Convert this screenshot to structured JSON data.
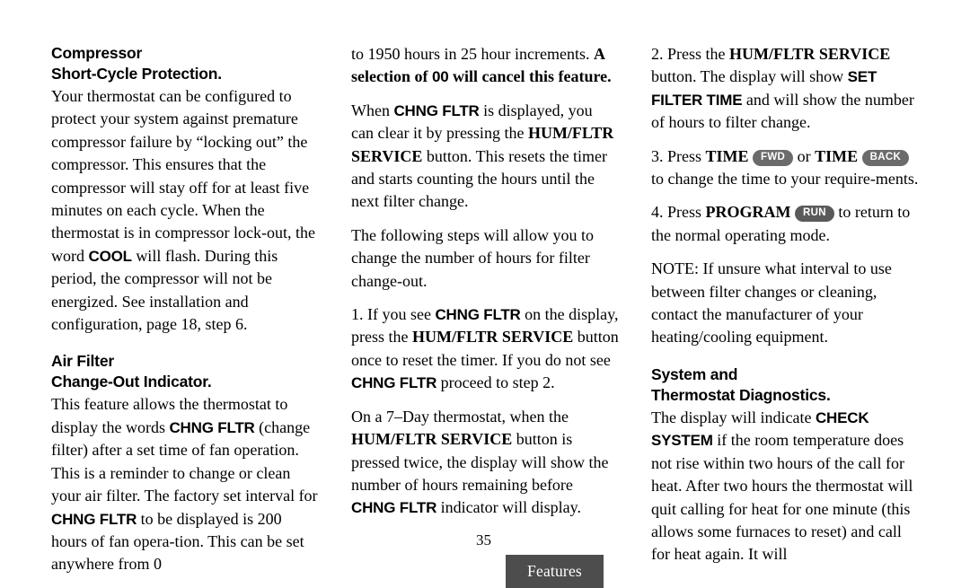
{
  "document": {
    "page_number": "35",
    "footer_tab_label": "Features",
    "footer_tab_color": "#4d4d4d",
    "key_badge_color": "#6b6b6b",
    "key_badge_color_dark": "#5a5a5a"
  },
  "columns": [
    {
      "id": "column-left",
      "blocks": [
        {
          "type": "heading",
          "line1": "Compressor",
          "line2": "Short-Cycle Protection."
        },
        {
          "type": "paragraph",
          "id": "compressor-body",
          "runs": [
            {
              "style": "plain",
              "text": "Your thermostat can be configured to protect your system against premature compressor failure by “locking out” the compressor. This ensures that the compressor will stay off for at least five minutes on each cycle. When the thermostat is in compressor lock-out, the word "
            },
            {
              "style": "display",
              "text": "COOL"
            },
            {
              "style": "plain",
              "text": " will flash. During this period, the compressor will not be energized. See installation and configuration, page 18, step 6."
            }
          ]
        },
        {
          "type": "heading",
          "line1": "Air Filter",
          "line2": "Change-Out Indicator."
        },
        {
          "type": "paragraph",
          "id": "air-filter-body",
          "runs": [
            {
              "style": "plain",
              "text": "This feature allows the thermostat to display the words "
            },
            {
              "style": "display",
              "text": "CHNG FLTR"
            },
            {
              "style": "plain",
              "text": " (change filter) after a set time of fan operation. This is a reminder to change or clean your air filter. The factory set interval for "
            },
            {
              "style": "display",
              "text": "CHNG FLTR"
            },
            {
              "style": "plain",
              "text": " to be displayed is 200 hours of fan opera-tion. This can be set anywhere from 0"
            }
          ]
        }
      ]
    },
    {
      "id": "column-middle",
      "blocks": [
        {
          "type": "paragraph",
          "id": "increment-range",
          "runs": [
            {
              "style": "plain",
              "text": "to 1950 hours in 25 hour increments. "
            },
            {
              "style": "bold-serif",
              "text": "A selection of "
            },
            {
              "style": "display",
              "text": "00"
            },
            {
              "style": "bold-serif",
              "text": " will cancel this feature."
            }
          ]
        },
        {
          "type": "paragraph",
          "id": "clear-chng-fltr",
          "runs": [
            {
              "style": "plain",
              "text": "When "
            },
            {
              "style": "display",
              "text": "CHNG FLTR"
            },
            {
              "style": "plain",
              "text": " is displayed, you can clear it by pressing the "
            },
            {
              "style": "bold-serif",
              "text": "HUM/FLTR SERVICE"
            },
            {
              "style": "plain",
              "text": " button. This resets the timer and starts counting the hours until the next filter change."
            }
          ]
        },
        {
          "type": "paragraph",
          "id": "following-steps-intro",
          "runs": [
            {
              "style": "plain",
              "text": "The following steps will allow you to change the number of hours for filter change-out."
            }
          ]
        },
        {
          "type": "paragraph",
          "id": "step-1",
          "runs": [
            {
              "style": "plain",
              "text": "1. If you see "
            },
            {
              "style": "display",
              "text": "CHNG FLTR"
            },
            {
              "style": "plain",
              "text": " on the display, press the "
            },
            {
              "style": "bold-serif",
              "text": "HUM/FLTR SERVICE"
            },
            {
              "style": "plain",
              "text": " button once to reset the timer. If you do not see "
            },
            {
              "style": "display",
              "text": "CHNG FLTR"
            },
            {
              "style": "plain",
              "text": " proceed to step 2."
            }
          ]
        },
        {
          "type": "paragraph",
          "id": "seven-day-note",
          "runs": [
            {
              "style": "plain",
              "text": "On a 7–Day thermostat, when the "
            },
            {
              "style": "bold-serif",
              "text": "HUM/FLTR SERVICE"
            },
            {
              "style": "plain",
              "text": " button is pressed twice, the display will show the number of hours remaining before "
            },
            {
              "style": "display",
              "text": "CHNG FLTR"
            },
            {
              "style": "plain",
              "text": " indicator will display."
            }
          ]
        }
      ]
    },
    {
      "id": "column-right",
      "blocks": [
        {
          "type": "paragraph",
          "id": "step-2",
          "runs": [
            {
              "style": "plain",
              "text": "2. Press the "
            },
            {
              "style": "bold-serif",
              "text": "HUM/FLTR SERVICE"
            },
            {
              "style": "plain",
              "text": " button. The display will show "
            },
            {
              "style": "display",
              "text": "SET FILTER TIME"
            },
            {
              "style": "plain",
              "text": " and will show the number of hours to filter change."
            }
          ]
        },
        {
          "type": "paragraph",
          "id": "step-3",
          "runs": [
            {
              "style": "plain",
              "text": "3. Press "
            },
            {
              "style": "bold-serif",
              "text": "TIME"
            },
            {
              "style": "plain",
              "text": " "
            },
            {
              "style": "key",
              "text": "FWD"
            },
            {
              "style": "plain",
              "text": " or "
            },
            {
              "style": "bold-serif",
              "text": "TIME"
            },
            {
              "style": "plain",
              "text": " "
            },
            {
              "style": "key",
              "text": "BACK"
            },
            {
              "style": "plain",
              "text": " to change the time to your require-ments."
            }
          ]
        },
        {
          "type": "paragraph",
          "id": "step-4",
          "runs": [
            {
              "style": "plain",
              "text": "4. Press "
            },
            {
              "style": "bold-serif",
              "text": "PROGRAM"
            },
            {
              "style": "plain",
              "text": " "
            },
            {
              "style": "key-dark",
              "text": "RUN"
            },
            {
              "style": "plain",
              "text": " to return to the normal operating mode."
            }
          ]
        },
        {
          "type": "paragraph",
          "id": "note-interval",
          "runs": [
            {
              "style": "plain",
              "text": "NOTE: If unsure what interval to use between filter changes or cleaning, contact the manufacturer of your heating/cooling equipment."
            }
          ]
        },
        {
          "type": "heading",
          "line1": "System and",
          "line2": "Thermostat Diagnostics."
        },
        {
          "type": "paragraph",
          "id": "diagnostics-body",
          "runs": [
            {
              "style": "plain",
              "text": "The display will indicate "
            },
            {
              "style": "display",
              "text": "CHECK SYSTEM"
            },
            {
              "style": "plain",
              "text": " if the room temperature does not rise within two hours of the call for heat. After two hours the thermostat will quit calling for heat for one minute (this allows some furnaces to reset) and call for heat again. It will"
            }
          ]
        }
      ]
    }
  ]
}
